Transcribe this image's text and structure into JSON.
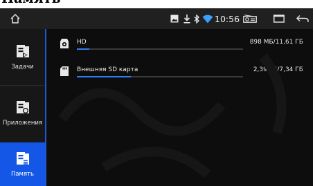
{
  "page_title": "Память",
  "statusbar": {
    "clock": "10:56",
    "icons": [
      "home-icon",
      "image-icon",
      "download-icon",
      "bluetooth-icon",
      "wifi-icon",
      "radio-icon",
      "window-icon",
      "back-icon"
    ]
  },
  "sidebar": {
    "items": [
      {
        "label": "Задачи",
        "icon": "tasks-icon",
        "active": false
      },
      {
        "label": "Приложения",
        "icon": "apps-icon",
        "active": false
      },
      {
        "label": "Память",
        "icon": "memory-icon",
        "active": true
      }
    ]
  },
  "storage": [
    {
      "name": "HD",
      "size": "898 МБ/11,61 ГБ",
      "used_fraction": 0.076,
      "icon": "phone-storage-icon"
    },
    {
      "name": "Внешняя SD карта",
      "size": "2,39 ГБ/7,34 ГБ",
      "used_fraction": 0.326,
      "icon": "sd-card-icon"
    }
  ],
  "colors": {
    "accent": "#1457e6",
    "progress": "#2f7ef5",
    "background": "#0d0d0d"
  }
}
